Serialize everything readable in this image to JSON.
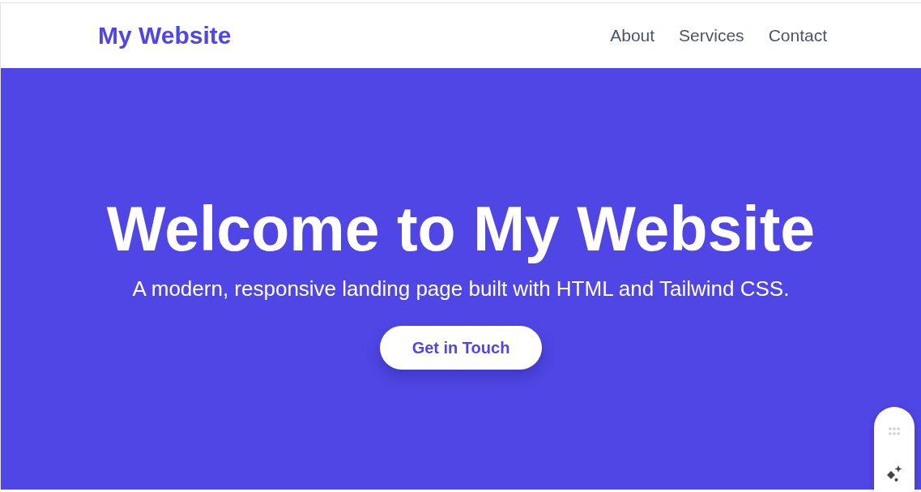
{
  "header": {
    "logo": "My Website",
    "nav": [
      {
        "label": "About"
      },
      {
        "label": "Services"
      },
      {
        "label": "Contact"
      }
    ]
  },
  "hero": {
    "title": "Welcome to My Website",
    "subtitle": "A modern, responsive landing page built with HTML and Tailwind CSS.",
    "button": "Get in Touch"
  }
}
